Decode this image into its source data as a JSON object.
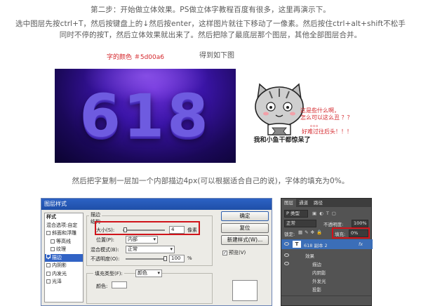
{
  "text": {
    "step_line": "第二步：开始做立体效果。PS做立体字教程百度有很多，这里再演示下。",
    "instr_line1": "选中图层先按ctrl+T，然后按键盘上的↓然后按enter，这样图片就往下移动了一像素。然后按住ctrl+alt+shift不松手",
    "instr_line2": "同时不停的按T，然后立体效果就出来了。然后把除了最底层那个图层，其他全部图层合并。",
    "font_color_note": "字的颜色 ＃5d00a6",
    "result_caption": "得到如下图",
    "copy_instruction": "然后把字复制一层加一个内部描边4px(可以根据适合自己的说)，字体的填充为0%。"
  },
  "banner": {
    "number": "618"
  },
  "meme": {
    "caption": "我和小鱼干都惊呆了",
    "bubble_line1": "这是些什么啊，",
    "bubble_line2": "怎么可以这么丑 ？？",
    "bubble_line3": "。。。",
    "bubble_line4": "好难过往后头！！！"
  },
  "dialog": {
    "title": "图层样式",
    "styles_header": "样式",
    "blend_options": "混合选项:自定",
    "left_items": [
      "斜面和浮雕",
      "等高线",
      "纹理",
      "描边",
      "内阴影",
      "内发光",
      "光泽"
    ],
    "section_title": "描边",
    "structure_label": "结构",
    "size_label": "大小(S):",
    "size_value": "4",
    "size_unit": "像素",
    "position_label": "位置(P):",
    "position_value": "内部",
    "blend_mode_label": "混合模式(B):",
    "blend_mode_value": "正常",
    "opacity_label": "不透明度(O):",
    "opacity_value": "100",
    "opacity_unit": "%",
    "fill_type_label": "填充类型(F):",
    "fill_type_value": "颜色",
    "color_label": "颜色:",
    "buttons": {
      "ok": "确定",
      "reset": "复位",
      "new_style": "新建样式(W)...",
      "preview": "预览(V)"
    }
  },
  "layers": {
    "tabs": [
      "图层",
      "通道",
      "路径"
    ],
    "kind_label": "P 类型",
    "blend_mode": "正常",
    "opacity_label": "不透明度:",
    "opacity_value": "100%",
    "lock_label": "锁定:",
    "fill_label": "填充:",
    "fill_value": "0%",
    "layer_name": "618 副本 2",
    "fx_badge": "fx",
    "effects_label": "效果",
    "effects": [
      "描边",
      "内阴影",
      "外发光",
      "投影"
    ]
  },
  "colors": {
    "font_color": "#5d00a6",
    "annotation_red": "#d4262b",
    "highlight_red": "#d0131a",
    "selection_blue": "#3b6eb8"
  }
}
